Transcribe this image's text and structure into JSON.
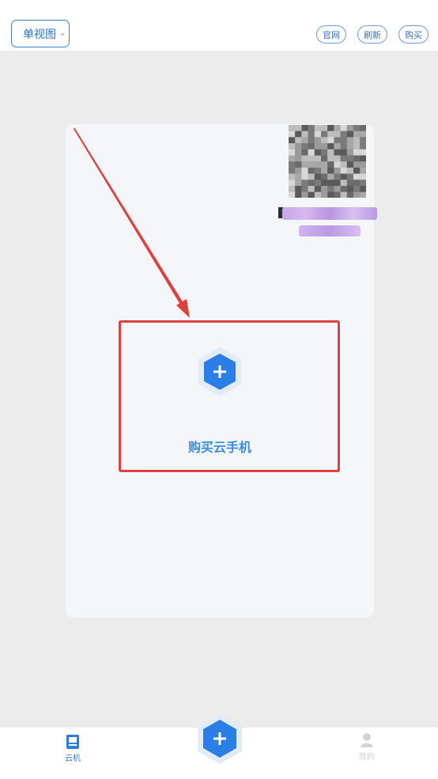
{
  "header": {
    "view_mode": "单视图",
    "buttons": {
      "official": "官网",
      "refresh": "刷新",
      "buy": "购买"
    }
  },
  "card": {
    "action_label": "购买云手机"
  },
  "bottom_nav": {
    "cloud_label": "云机",
    "mine_label": "我的"
  },
  "colors": {
    "accent": "#2f6fbf",
    "highlight": "#e0403c",
    "action_text": "#3b8de0"
  }
}
